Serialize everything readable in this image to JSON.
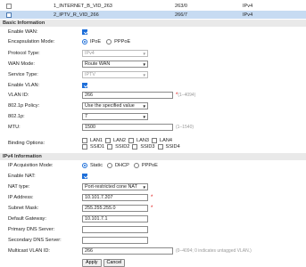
{
  "wan_list": [
    {
      "name": "1_INTERNET_B_VID_263",
      "vlan": "263/0",
      "ip": "IPv4",
      "checked": false
    },
    {
      "name": "2_IPTV_R_VID_266",
      "vlan": "266/7",
      "ip": "IPv4",
      "checked": true
    }
  ],
  "basic": {
    "title": "Basic Information",
    "enable_wan_label": "Enable WAN:",
    "encap_label": "Encapsulation Mode:",
    "encap_ipoe": "IPoE",
    "encap_pppoe": "PPPoE",
    "protocol_label": "Protocol Type:",
    "protocol_value": "IPv4",
    "wan_mode_label": "WAN Mode:",
    "wan_mode_value": "Route WAN",
    "service_label": "Service Type:",
    "service_value": "IPTV",
    "enable_vlan_label": "Enable VLAN:",
    "vlan_id_label": "VLAN ID:",
    "vlan_id_value": "266",
    "vlan_id_hint": "(1–4094)",
    "policy_label": "802.1p Policy:",
    "policy_value": "Use the specified value",
    "p_label": "802.1p:",
    "p_value": "7",
    "mtu_label": "MTU:",
    "mtu_value": "1500",
    "mtu_hint": "(1–1540)",
    "binding_label": "Binding Options:",
    "lan_opts": [
      "LAN1",
      "LAN2",
      "LAN3",
      "LAN4"
    ],
    "ssid_opts": [
      "SSID1",
      "SSID2",
      "SSID3",
      "SSID4"
    ]
  },
  "ipv4": {
    "title": "IPv4 Information",
    "acq_label": "IP Acquisition Mode:",
    "acq_static": "Static",
    "acq_dhcp": "DHCP",
    "acq_pppoe": "PPPoE",
    "nat_enable_label": "Enable NAT:",
    "nat_type_label": "NAT type:",
    "nat_type_value": "Port-restricted cone NAT",
    "ip_label": "IP Address:",
    "ip_value": "10.101.7.207",
    "mask_label": "Subnet Mask:",
    "mask_value": "255.255.255.0",
    "gw_label": "Default Gateway:",
    "gw_value": "10.101.7.1",
    "dns1_label": "Primary DNS Server:",
    "dns1_value": "",
    "dns2_label": "Secondary DNS Server:",
    "dns2_value": "",
    "mcast_label": "Multicast VLAN ID:",
    "mcast_value": "266",
    "mcast_hint": "(0–4094; 0 indicates untagged VLAN.)"
  },
  "buttons": {
    "apply": "Apply",
    "cancel": "Cancel"
  },
  "req_mark": "*"
}
